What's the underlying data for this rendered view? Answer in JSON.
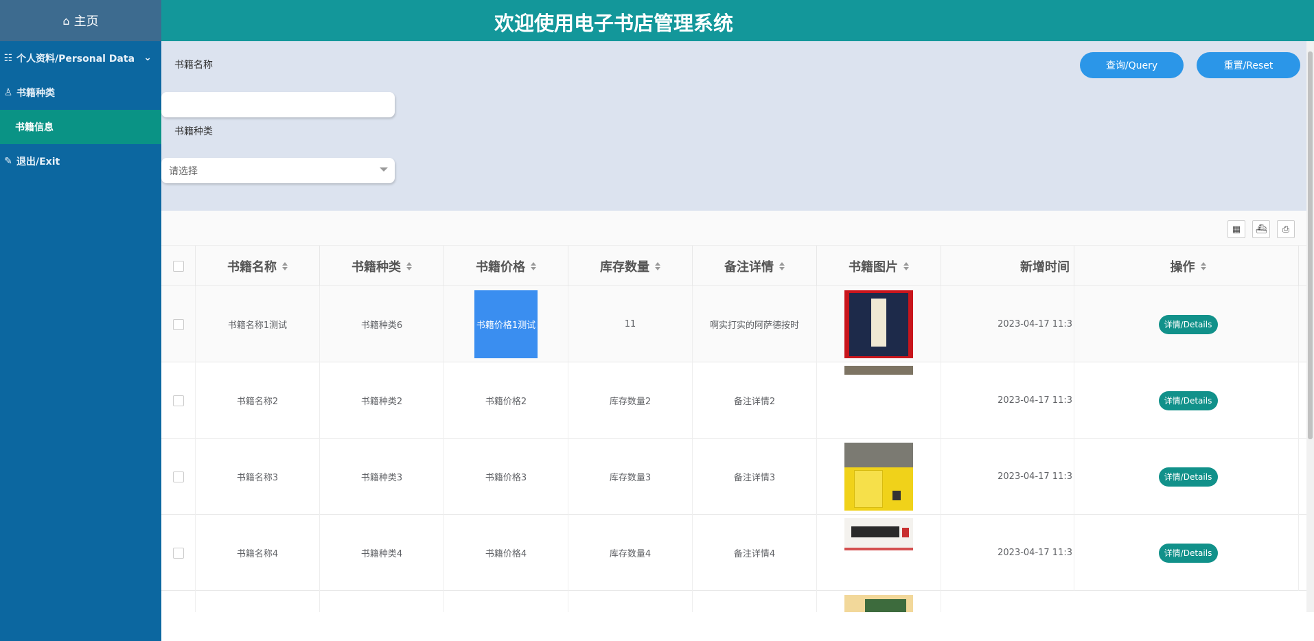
{
  "app": {
    "title": "欢迎使用电子书店管理系统"
  },
  "sidebar": {
    "home": "主页",
    "items": [
      {
        "label": "个人资料/Personal Data",
        "icon": "user-card-icon"
      },
      {
        "label": "书籍种类",
        "icon": "user-icon"
      },
      {
        "label": "书籍信息",
        "icon": "",
        "active": true
      },
      {
        "label": "退出/Exit",
        "icon": "exit-icon"
      }
    ]
  },
  "filter": {
    "name_label": "书籍名称",
    "name_value": "",
    "type_label": "书籍种类",
    "type_placeholder": "请选择",
    "query_label": "查询/Query",
    "reset_label": "重置/Reset"
  },
  "table": {
    "headers": [
      "书籍名称",
      "书籍种类",
      "书籍价格",
      "库存数量",
      "备注详情",
      "书籍图片",
      "新增时间",
      "操作"
    ],
    "rows": [
      {
        "name": "书籍名称1测试",
        "type": "书籍种类6",
        "price": "书籍价格1测试",
        "stock": "11",
        "note": "啊实打实的阿萨德按时",
        "time": "2023-04-17 11:3",
        "action": "详情/Details"
      },
      {
        "name": "书籍名称2",
        "type": "书籍种类2",
        "price": "书籍价格2",
        "stock": "库存数量2",
        "note": "备注详情2",
        "time": "2023-04-17 11:3",
        "action": "详情/Details"
      },
      {
        "name": "书籍名称3",
        "type": "书籍种类3",
        "price": "书籍价格3",
        "stock": "库存数量3",
        "note": "备注详情3",
        "time": "2023-04-17 11:3",
        "action": "详情/Details"
      },
      {
        "name": "书籍名称4",
        "type": "书籍种类4",
        "price": "书籍价格4",
        "stock": "库存数量4",
        "note": "备注详情4",
        "time": "2023-04-17 11:3",
        "action": "详情/Details"
      }
    ]
  },
  "colors": {
    "sidebar": "#0c67a0",
    "topbar": "#13979a",
    "active_menu": "#0a9385",
    "accent": "#2b96e8"
  }
}
